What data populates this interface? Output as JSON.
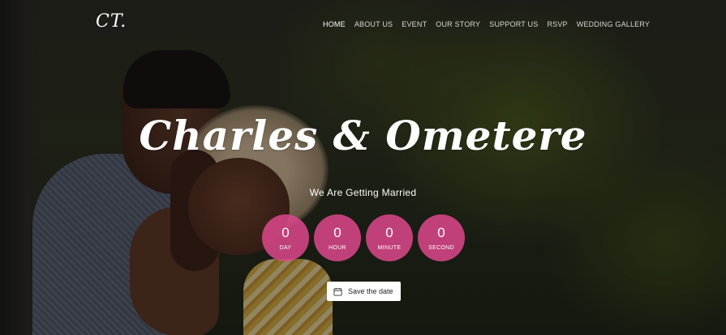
{
  "header": {
    "logo": "CT.",
    "nav": [
      {
        "label": "HOME",
        "active": true
      },
      {
        "label": "ABOUT US",
        "active": false
      },
      {
        "label": "EVENT",
        "active": false
      },
      {
        "label": "OUR STORY",
        "active": false
      },
      {
        "label": "SUPPORT US",
        "active": false
      },
      {
        "label": "RSVP",
        "active": false
      },
      {
        "label": "WEDDING GALLERY",
        "active": false
      }
    ]
  },
  "hero": {
    "title": "Charles & Ometere",
    "subtitle": "We Are Getting Married",
    "countdown": [
      {
        "value": "0",
        "label": "DAY"
      },
      {
        "value": "0",
        "label": "HOUR"
      },
      {
        "value": "0",
        "label": "MINUTE"
      },
      {
        "value": "0",
        "label": "SECOND"
      }
    ],
    "save_button": {
      "label": "Save the date",
      "icon": "calendar-icon"
    }
  },
  "colors": {
    "accent": "#de488c",
    "text": "#ffffff"
  }
}
